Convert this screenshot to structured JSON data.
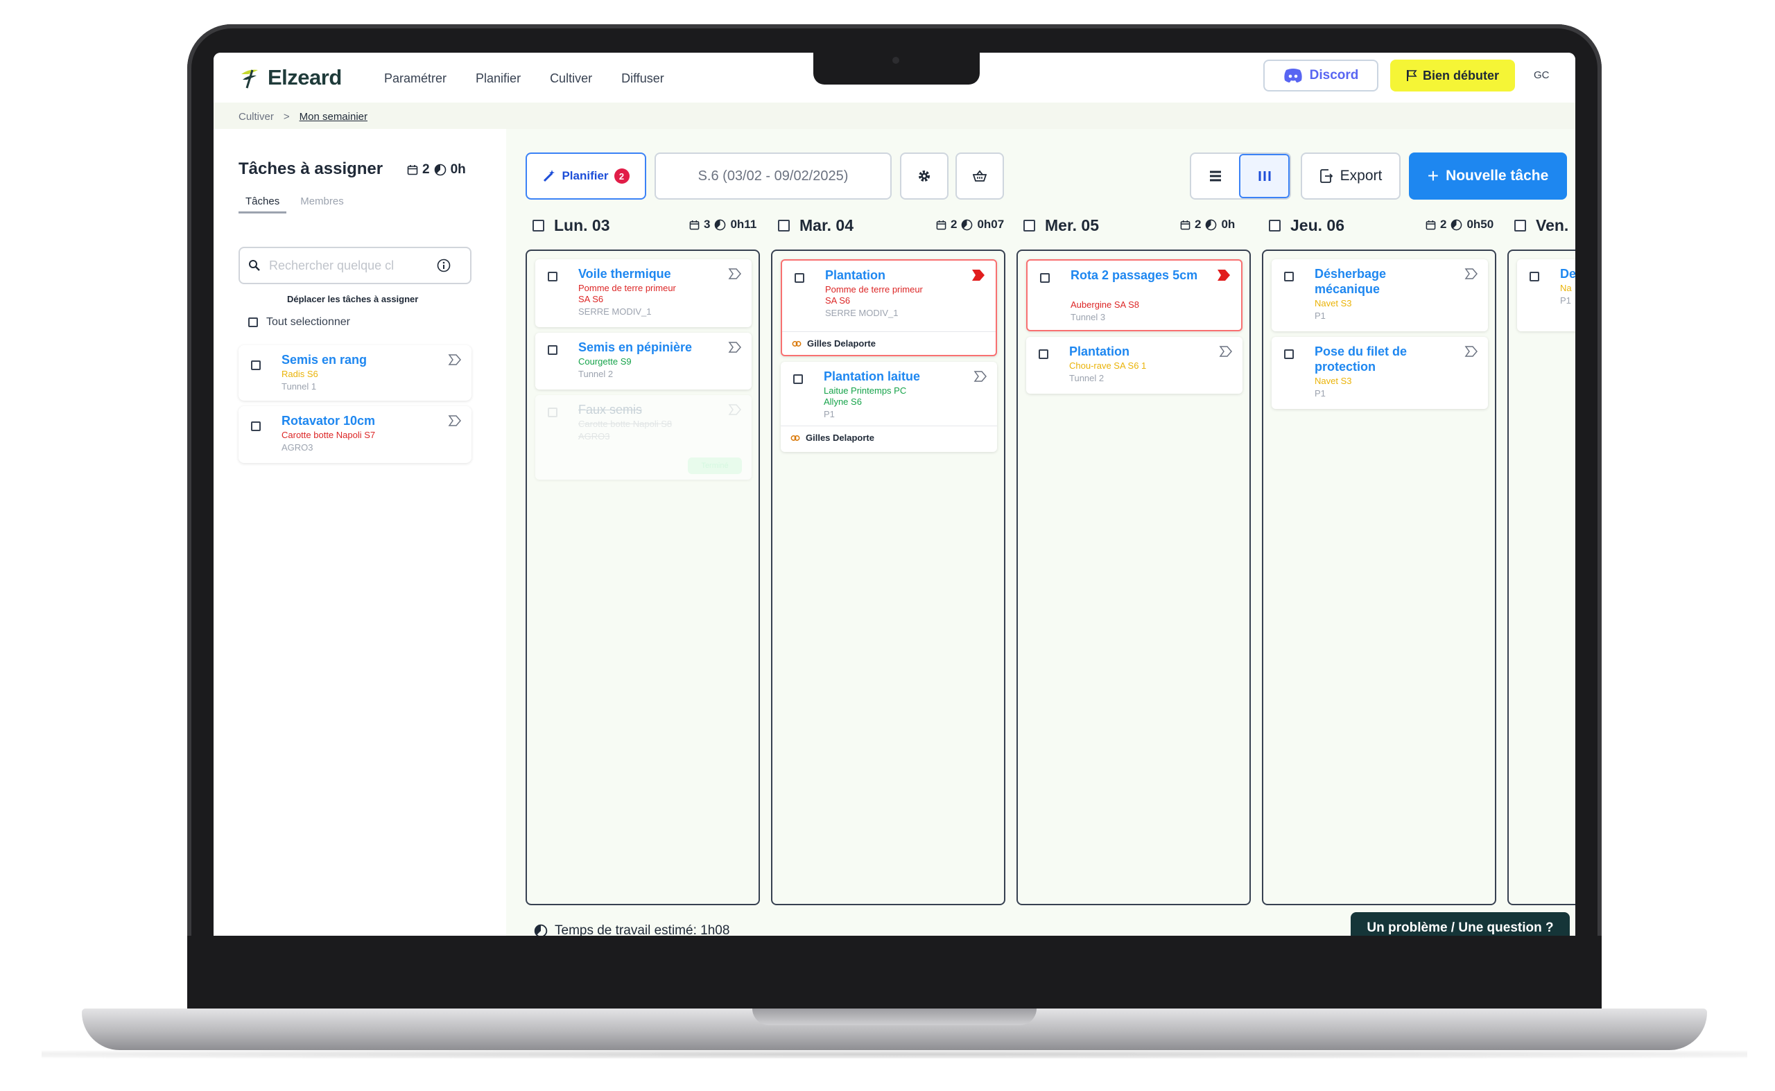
{
  "header": {
    "brand": "Elzeard",
    "nav": [
      "Paramétrer",
      "Planifier",
      "Cultiver",
      "Diffuser"
    ],
    "discord_label": "Discord",
    "bien_debuter_label": "Bien débuter",
    "avatar_initials": "GC",
    "colors": {
      "brand_green": "#1f3b3a",
      "accent_blue": "#1e87f0",
      "discord": "#5865F2",
      "highlight_yellow": "#f5f536"
    }
  },
  "breadcrumb": {
    "parent": "Cultiver",
    "separator": ">",
    "current": "Mon semainier"
  },
  "left_panel": {
    "title": "Tâches à assigner",
    "task_count": "2",
    "time_total": "0h",
    "tabs": [
      "Tâches",
      "Membres"
    ],
    "search_placeholder": "Rechercher quelque cl",
    "move_hint": "Déplacer les tâches à assigner",
    "select_all": "Tout selectionner",
    "tasks": [
      {
        "title": "Semis en rang",
        "crop": "Radis S6",
        "location": "Tunnel 1"
      },
      {
        "title": "Rotavator 10cm",
        "crop": "Carotte botte Napoli S7",
        "location": "AGRO3"
      }
    ]
  },
  "toolbar": {
    "planifier_label": "Planifier",
    "planifier_badge": "2",
    "week_label": "S.6 (03/02 - 09/02/2025)",
    "export_label": "Export",
    "new_task_label": "Nouvelle tâche"
  },
  "days": [
    {
      "name": "Lun. 03",
      "count": "3",
      "time": "0h11",
      "tasks": [
        {
          "title": "Voile thermique",
          "lines": [
            "Pomme de terre primeur",
            "SA S6"
          ],
          "location": "SERRE MODIV_1"
        },
        {
          "title": "Semis en pépinière",
          "lines": [
            "Courgette S9"
          ],
          "location": "Tunnel 2"
        },
        {
          "title": "Faux semis",
          "lines": [
            "Carotte botte Napoli S8"
          ],
          "location": "AGRO3",
          "done_label": "Terminé"
        }
      ]
    },
    {
      "name": "Mar. 04",
      "count": "2",
      "time": "0h07",
      "tasks": [
        {
          "title": "Plantation",
          "lines": [
            "Pomme de terre primeur",
            "SA S6"
          ],
          "location": "SERRE MODIV_1",
          "assignee": "Gilles Delaporte"
        },
        {
          "title": "Plantation laitue",
          "lines": [
            "Laitue Printemps PC",
            "Allyne S6"
          ],
          "location": "P1",
          "assignee": "Gilles Delaporte"
        }
      ]
    },
    {
      "name": "Mer. 05",
      "count": "2",
      "time": "0h",
      "tasks": [
        {
          "title": "Rota 2 passages 5cm",
          "lines": [
            "Aubergine SA S8"
          ],
          "location": "Tunnel 3"
        },
        {
          "title": "Plantation",
          "lines": [
            "Chou-rave SA S6 1"
          ],
          "location": "Tunnel 2"
        }
      ]
    },
    {
      "name": "Jeu. 06",
      "count": "2",
      "time": "0h50",
      "tasks": [
        {
          "title": "Désherbage mécanique",
          "lines": [
            "Navet S3"
          ],
          "location": "P1"
        },
        {
          "title": "Pose du filet de protection",
          "lines": [
            "Navet S3"
          ],
          "location": "P1"
        }
      ]
    },
    {
      "name": "Ven.",
      "tasks": [
        {
          "title": "De",
          "lines": [
            "Na"
          ],
          "location": "P1"
        }
      ]
    }
  ],
  "footer": {
    "estimated_time": "Temps de travail estimé: 1h08",
    "help_button": "Un problème / Une question ?"
  }
}
